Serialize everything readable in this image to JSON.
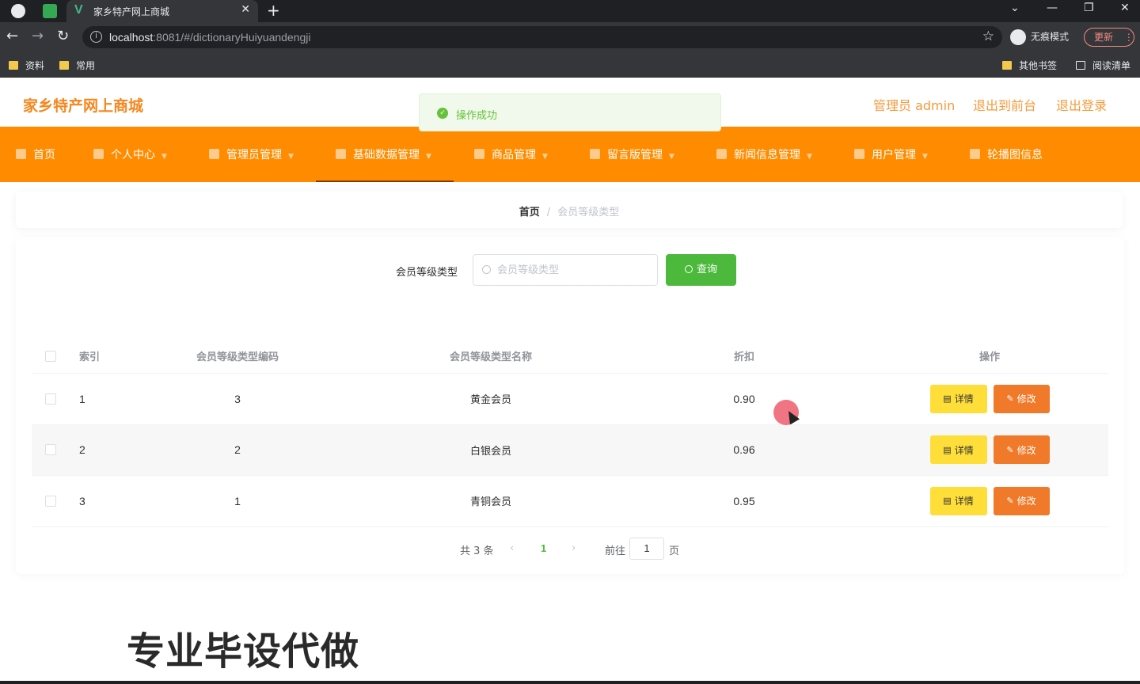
{
  "browser": {
    "tab_title": "家乡特产网上商城",
    "url_host": "localhost",
    "url_rest": ":8081/#/dictionaryHuiyuandengji",
    "incognito_label": "无痕模式",
    "update_label": "更新",
    "bookmarks": [
      "资料",
      "常用"
    ],
    "bookmarks_right": [
      "其他书签",
      "阅读清单"
    ]
  },
  "header": {
    "brand": "家乡特产网上商城",
    "admin": "管理员 admin",
    "to_front": "退出到前台",
    "logout": "退出登录"
  },
  "toast": {
    "message": "操作成功"
  },
  "nav": [
    {
      "label": "首页",
      "icon": "home-icon"
    },
    {
      "label": "个人中心",
      "icon": "user-icon"
    },
    {
      "label": "管理员管理",
      "icon": "admin-icon"
    },
    {
      "label": "基础数据管理",
      "icon": "data-icon"
    },
    {
      "label": "商品管理",
      "icon": "goods-icon"
    },
    {
      "label": "留言版管理",
      "icon": "message-icon"
    },
    {
      "label": "新闻信息管理",
      "icon": "news-icon"
    },
    {
      "label": "用户管理",
      "icon": "users-icon"
    },
    {
      "label": "轮播图信息",
      "icon": "carousel-icon"
    }
  ],
  "breadcrumb": {
    "home": "首页",
    "sep": "/",
    "current": "会员等级类型"
  },
  "search": {
    "label": "会员等级类型",
    "placeholder": "会员等级类型",
    "button": "查询"
  },
  "table": {
    "headers": [
      "索引",
      "会员等级类型编码",
      "会员等级类型名称",
      "折扣",
      "操作"
    ],
    "rows": [
      {
        "index": "1",
        "code": "3",
        "name": "黄金会员",
        "discount": "0.90"
      },
      {
        "index": "2",
        "code": "2",
        "name": "白银会员",
        "discount": "0.96"
      },
      {
        "index": "3",
        "code": "1",
        "name": "青铜会员",
        "discount": "0.95"
      }
    ],
    "detail_label": "详情",
    "edit_label": "修改"
  },
  "pagination": {
    "total": "共 3 条",
    "prev": "‹",
    "current": "1",
    "next": "›",
    "goto": "前往",
    "page_input": "1",
    "unit": "页"
  },
  "watermark": "专业毕设代做"
}
